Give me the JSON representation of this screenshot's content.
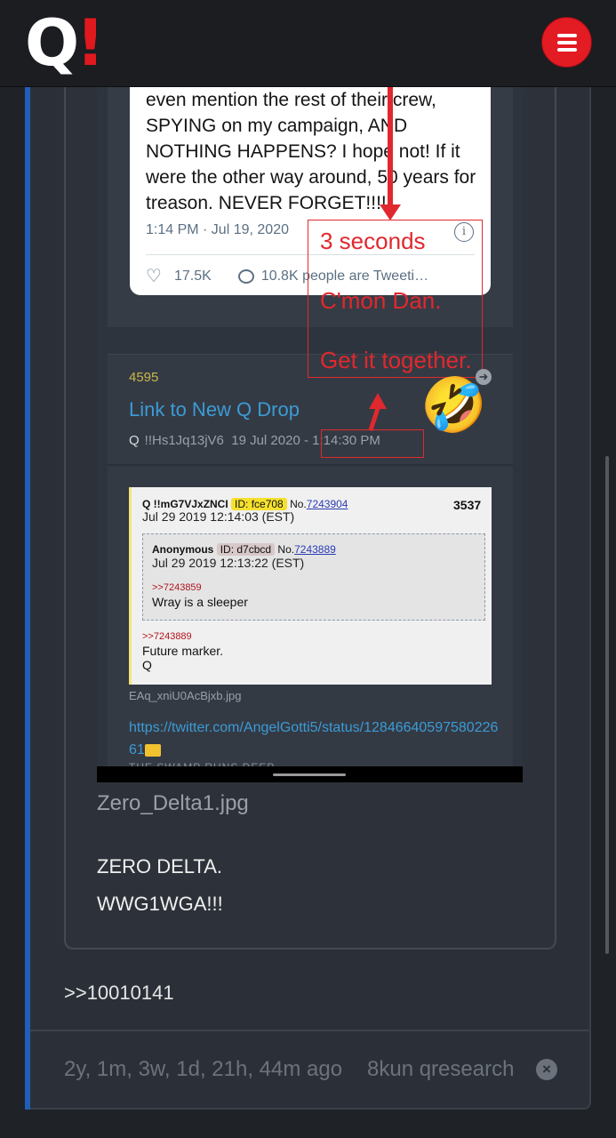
{
  "header": {
    "logo_q": "Q",
    "logo_bang": "!",
    "menu_icon": "hamburger-icon",
    "accent_color": "#e31b23"
  },
  "screenshot": {
    "tweet": {
      "text": "even mention the rest of their crew, SPYING on my campaign, AND NOTHING HAPPENS? I hope not! If it were the other way around, 50 years for treason. NEVER FORGET!!!!",
      "time": "1:14 PM · Jul 19, 2020",
      "likes": "17.5K",
      "replies_text": "10.8K people are Tweeti…"
    },
    "annotation": {
      "line1": "3 seconds",
      "line2": "C'mon Dan.",
      "line3": "Get it together."
    },
    "drop": {
      "number": "4595",
      "link": "Link to New Q Drop",
      "author": "Q",
      "tripcode": "!!Hs1Jq13jV6",
      "date": "19 Jul 2020",
      "time": "- 1:14:30 PM"
    },
    "board": {
      "head_name": "Q !!mG7VJxZNCI",
      "head_id": "ID: fce708",
      "head_no_label": "No.",
      "head_no": "7243904",
      "head_date": "Jul 29 2019 12:14:03 (EST)",
      "count": "3537",
      "reply_name": "Anonymous",
      "reply_id": "ID: d7cbcd",
      "reply_no_label": "No.",
      "reply_no": "7243889",
      "reply_date": "Jul 29 2019 12:13:22 (EST)",
      "reply_ref": ">>7243859",
      "reply_msg": "Wray is a sleeper",
      "ref2": ">>7243889",
      "msg2_line1": "Future marker.",
      "msg2_line2": "Q"
    },
    "image_name": "EAq_xniU0AcBjxb.jpg",
    "twitter_link": "https://twitter.com/AngelGotti5/status/1284664059758022661",
    "cut_text": "THE SWAMP RUNS DEEP"
  },
  "post": {
    "file_name": "Zero_Delta1.jpg",
    "caption1": "ZERO DELTA.",
    "caption2": "WWG1WGA!!!",
    "reference": ">>10010141",
    "age": "2y, 1m, 3w, 1d, 21h, 44m ago",
    "source": "8kun qresearch"
  }
}
